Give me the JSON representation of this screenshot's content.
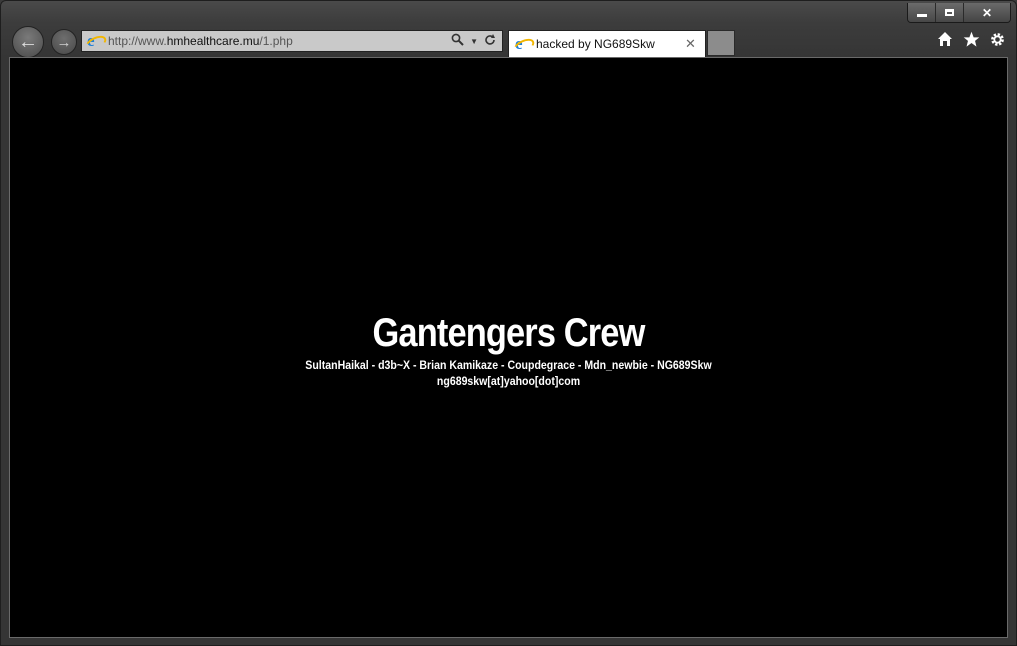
{
  "browser": {
    "address_url_prefix": "http://www.",
    "address_url_domain": "hmhealthcare.mu",
    "address_url_path": "/1.php",
    "tab_title": "hacked by NG689Skw"
  },
  "page": {
    "headline": "Gantengers Crew",
    "members": "SultanHaikal - d3b~X - Brian Kamikaze - Coupdegrace - Mdn_newbie - NG689Skw",
    "email": "ng689skw[at]yahoo[dot]com"
  },
  "icons": {
    "back": "back-arrow-icon",
    "forward": "forward-arrow-icon",
    "search": "search-icon",
    "refresh": "refresh-icon",
    "home": "home-icon",
    "favorites": "star-icon",
    "settings": "gear-icon"
  }
}
